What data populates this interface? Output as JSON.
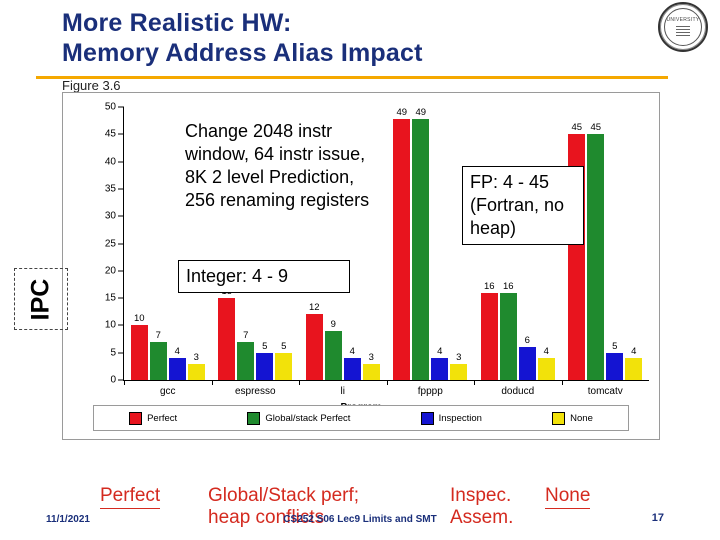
{
  "slide": {
    "title_line1": "More Realistic HW:",
    "title_line2": "Memory Address Alias Impact",
    "figure_label": "Figure 3.6",
    "logo_text": "UNIVERSITY",
    "accent_color": "#f5a800",
    "title_color": "#1a2f7a",
    "annotation_color": "#d42a1f"
  },
  "callouts": {
    "change": "Change  2048 instr window, 64 instr issue, 8K 2 level Prediction, 256 renaming registers",
    "fp": "FP: 4 - 45 (Fortran, no heap)",
    "integer": "Integer: 4 - 9"
  },
  "axis_side_label": "IPC",
  "annotations": {
    "perfect": "Perfect",
    "global": "Global/Stack perf; Inspec. Assem.",
    "global_line1": "Global/Stack perf;",
    "global_line2": "heap conflicts",
    "inspec_line1": "Inspec.",
    "inspec_line2": "Assem.",
    "none": "None"
  },
  "footer": {
    "date": "11/1/2021",
    "center": "CS252 S06 Lec9 Limits and SMT",
    "page": "17"
  },
  "chart_data": {
    "type": "bar",
    "title": "",
    "xlabel": "Program",
    "ylabel": "IPC",
    "ylim": [
      0,
      50
    ],
    "yticks": [
      0,
      5,
      10,
      15,
      20,
      25,
      30,
      35,
      40,
      45,
      50
    ],
    "grid": false,
    "legend_position": "bottom",
    "categories": [
      "gcc",
      "espresso",
      "li",
      "fpppp",
      "doducd",
      "tomcatv"
    ],
    "series": [
      {
        "name": "Perfect",
        "color": "#e8141e",
        "values": [
          10,
          15,
          12,
          49,
          16,
          45
        ]
      },
      {
        "name": "Global/stack Perfect",
        "color": "#1f8a2e",
        "values": [
          7,
          7,
          9,
          49,
          16,
          45
        ]
      },
      {
        "name": "Inspection",
        "color": "#1414d2",
        "values": [
          4,
          5,
          4,
          4,
          6,
          5
        ]
      },
      {
        "name": "None",
        "color": "#f2e20a",
        "values": [
          3,
          5,
          3,
          3,
          4,
          4
        ]
      }
    ]
  }
}
